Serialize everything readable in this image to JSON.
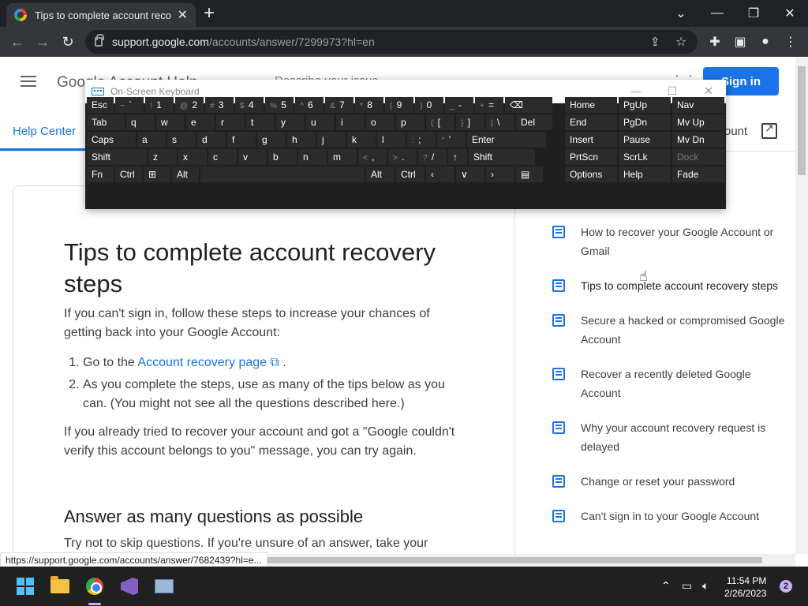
{
  "browser": {
    "tab_title": "Tips to complete account recovery steps - Google Account Help",
    "tab_close": "✕",
    "new_tab": "+",
    "url_domain": "support.google.com",
    "url_path": "/accounts/answer/7299973?hl=en",
    "status_url": "https://support.google.com/accounts/answer/7682439?hl=e..."
  },
  "header": {
    "logo_text": "Google Account Help",
    "search_placeholder": "Describe your issue",
    "signin_label": "Sign in",
    "help_center": "Help Center",
    "account_link": "ount"
  },
  "article": {
    "title": "Tips to complete account recovery steps",
    "intro": "If you can't sign in, follow these steps to increase your chances of getting back into your Google Account:",
    "step1_prefix": "Go to the ",
    "step1_link": "Account recovery page",
    "step1_suffix": " .",
    "step2": "As you complete the steps, use as many of the tips below as you can. (You might not see all the questions described here.)",
    "retry": "If you already tried to recover your account and got a \"Google couldn't verify this account belongs to you\" message, you can try again.",
    "h2": "Answer as many questions as possible",
    "cutoff": "Try not to skip questions. If you're unsure of an answer, take your"
  },
  "related": [
    "How to recover your Google Account or Gmail",
    "Tips to complete account recovery steps",
    "Secure a hacked or compromised Google Account",
    "Recover a recently deleted Google Account",
    "Why your account recovery request is delayed",
    "Change or reset your password",
    "Can't sign in to your Google Account"
  ],
  "osk": {
    "title": "On-Screen Keyboard",
    "rows": [
      [
        "Esc",
        "~ `",
        "! 1",
        "@ 2",
        "# 3",
        "$ 4",
        "% 5",
        "^ 6",
        "& 7",
        "* 8",
        "( 9",
        ") 0",
        "_ -",
        "+ =",
        "⌫"
      ],
      [
        "Tab",
        "q",
        "w",
        "e",
        "r",
        "t",
        "y",
        "u",
        "i",
        "o",
        "p",
        "{ [",
        "} ]",
        "| \\",
        "Del"
      ],
      [
        "Caps",
        "a",
        "s",
        "d",
        "f",
        "g",
        "h",
        "j",
        "k",
        "l",
        ": ;",
        "\" '",
        "Enter"
      ],
      [
        "Shift",
        "z",
        "x",
        "c",
        "v",
        "b",
        "n",
        "m",
        "< ,",
        "> .",
        "? /",
        "↑",
        "Shift"
      ],
      [
        "Fn",
        "Ctrl",
        "⊞",
        "Alt",
        "",
        "Alt",
        "Ctrl",
        "‹",
        "∨",
        "›",
        "▤"
      ]
    ],
    "nav": [
      [
        "Home",
        "PgUp",
        "Nav"
      ],
      [
        "End",
        "PgDn",
        "Mv Up"
      ],
      [
        "Insert",
        "Pause",
        "Mv Dn"
      ],
      [
        "PrtScn",
        "ScrLk",
        "Dock"
      ],
      [
        "Options",
        "Help",
        "Fade"
      ]
    ]
  },
  "taskbar": {
    "time": "11:54 PM",
    "date": "2/26/2023",
    "notifications": "2"
  }
}
